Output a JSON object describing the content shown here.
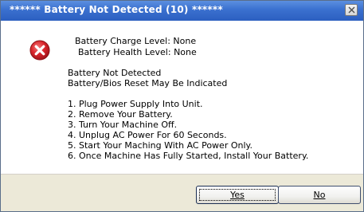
{
  "window": {
    "title": "****** Battery Not Detected (10) ******"
  },
  "icon": {
    "name": "error-icon",
    "color": "#d9252b"
  },
  "status": {
    "charge_level": "Battery Charge Level: None",
    "health_level": "Battery Health Level: None"
  },
  "messages": {
    "line1": "Battery Not Detected",
    "line2": "Battery/Bios Reset May Be Indicated"
  },
  "steps": [
    "1. Plug Power Supply Into Unit.",
    "2. Remove Your Battery.",
    "3. Turn Your Machine Off.",
    "4. Unplug AC Power For 60 Seconds.",
    "5. Start Your Maching With AC Power Only.",
    "6. Once Machine Has Fully Started, Install Your Battery."
  ],
  "buttons": {
    "yes_label": "Yes",
    "no_label": "No"
  }
}
